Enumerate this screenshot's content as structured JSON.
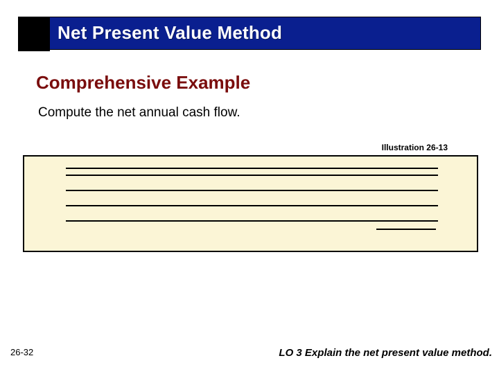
{
  "banner": {
    "title": "Net Present Value Method"
  },
  "section": {
    "title": "Comprehensive Example"
  },
  "instruction": "Compute the net annual cash flow.",
  "illustration": {
    "label": "Illustration 26-13"
  },
  "footer": {
    "page": "26-32",
    "lo": "LO 3  Explain the net present value method."
  }
}
